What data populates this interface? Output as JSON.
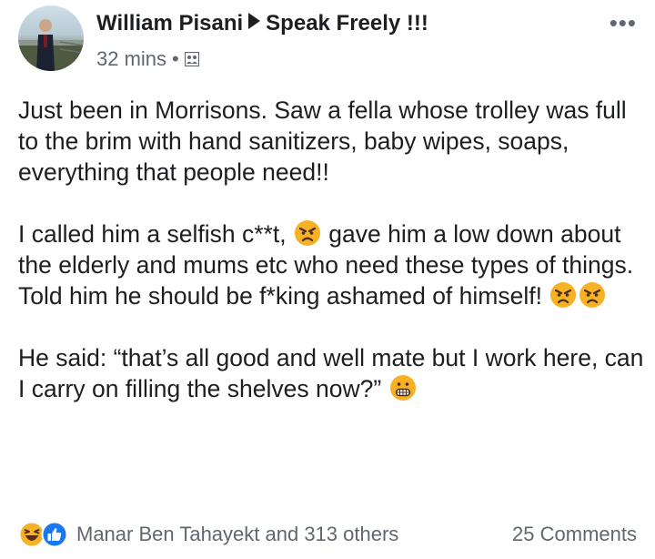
{
  "post": {
    "author": "William Pisani",
    "group": "Speak Freely !!!",
    "time": "32 mins",
    "separator": "•",
    "privacy_icon": "group-members-icon",
    "more_label": "•••",
    "paragraph1": "Just been in Morrisons. Saw a fella whose trolley was full to the brim with hand sanitizers, baby wipes, soaps, everything that people need!!",
    "paragraph2_a": "I called him a selfish c**t, ",
    "paragraph2_b": " gave him a low down about the elderly and mums etc who need these types of things. Told him he should be f*king ashamed of himself! ",
    "paragraph3": "He said: “that’s all good and well mate but I work here, can I carry on filling the shelves now?” ",
    "emojis": [
      "angry-face",
      "angry-face",
      "angry-face",
      "grimacing-face"
    ]
  },
  "footer": {
    "reactions_text": "Manar Ben Tahayekt and 313 others",
    "comments_text": "25 Comments",
    "reaction_icons": [
      "haha-reaction-icon",
      "like-reaction-icon"
    ],
    "like_color": "#1877f2",
    "haha_color": "#f7b125"
  }
}
